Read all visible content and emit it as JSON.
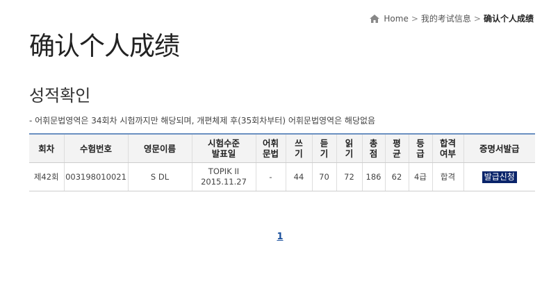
{
  "breadcrumb": {
    "home": "Home",
    "level1": "我的考试信息",
    "current": "确认个人成绩"
  },
  "page_title": "确认个人成绩",
  "section_title": "성적확인",
  "note": "- 어휘문법영역은 34회차 시험까지만 해당되며, 개편체제 후(35회차부터) 어휘문법영역은 해당없음",
  "table": {
    "headers": [
      [
        "회차"
      ],
      [
        "수험번호"
      ],
      [
        "영문이름"
      ],
      [
        "시험수준",
        "발표일"
      ],
      [
        "어휘",
        "문법"
      ],
      [
        "쓰",
        "기"
      ],
      [
        "듣",
        "기"
      ],
      [
        "읽",
        "기"
      ],
      [
        "총",
        "점"
      ],
      [
        "평",
        "균"
      ],
      [
        "등",
        "급"
      ],
      [
        "합격",
        "여부"
      ],
      [
        "증명서발급"
      ]
    ],
    "row": {
      "round": "제42회",
      "exam_no": "003198010021",
      "name": "S DL",
      "level": "TOPIK II",
      "date": "2015.11.27",
      "vocab_grammar": "-",
      "writing": "44",
      "listening": "70",
      "reading": "72",
      "total": "186",
      "average": "62",
      "grade": "4급",
      "pass": "합격",
      "certificate_button": "발급신청"
    }
  },
  "pagination": {
    "pages": [
      "1"
    ]
  }
}
